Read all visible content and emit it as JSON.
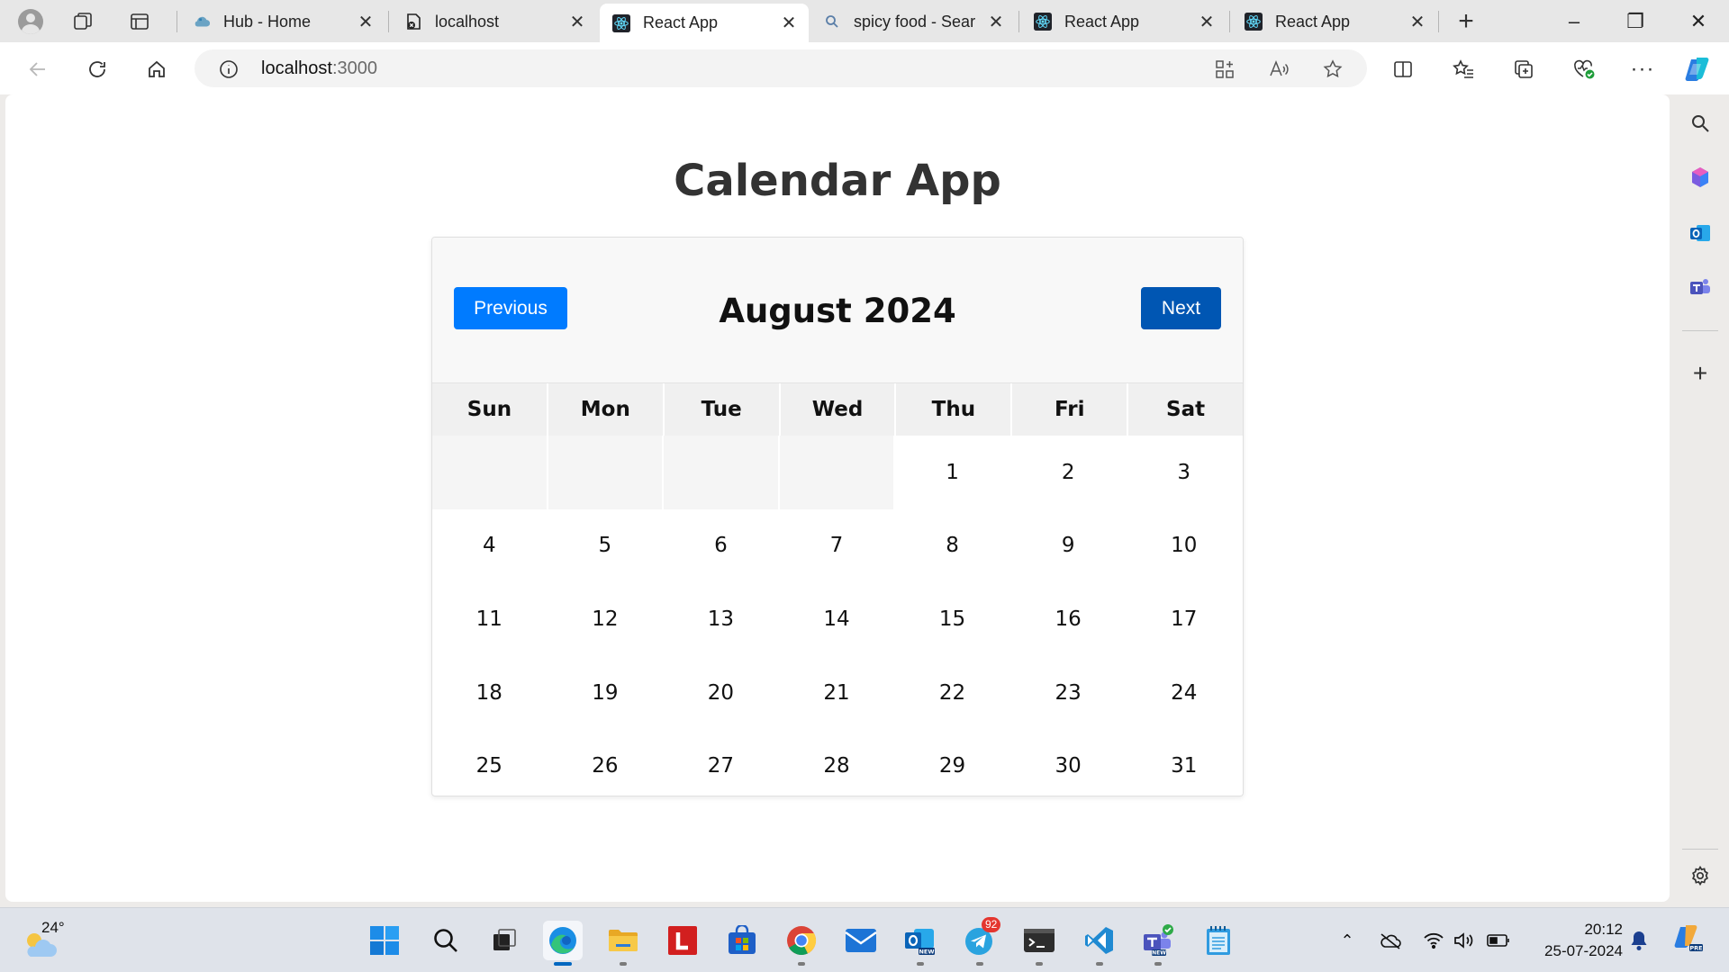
{
  "browser": {
    "tabs": [
      {
        "title": "Hub - Home",
        "favicon": "hub-cloud-icon",
        "active": false
      },
      {
        "title": "localhost",
        "favicon": "localhost-error-icon",
        "active": false
      },
      {
        "title": "React App",
        "favicon": "react-icon",
        "active": true
      },
      {
        "title": "spicy food - Sear",
        "favicon": "search-icon",
        "active": false
      },
      {
        "title": "React App",
        "favicon": "react-icon",
        "active": false
      },
      {
        "title": "React App",
        "favicon": "react-icon",
        "active": false
      }
    ],
    "new_tab_symbol": "+",
    "window_controls": {
      "minimize": "–",
      "restore": "❐",
      "close": "✕"
    },
    "address": {
      "host": "localhost",
      "port": ":3000"
    }
  },
  "page": {
    "title": "Calendar App",
    "calendar": {
      "month_label": "August 2024",
      "prev_label": "Previous",
      "next_label": "Next",
      "prev_color": "#007bff",
      "next_color": "#0056b3",
      "weekdays": [
        "Sun",
        "Mon",
        "Tue",
        "Wed",
        "Thu",
        "Fri",
        "Sat"
      ],
      "leading_blanks": 4,
      "days": [
        "1",
        "2",
        "3",
        "4",
        "5",
        "6",
        "7",
        "8",
        "9",
        "10",
        "11",
        "12",
        "13",
        "14",
        "15",
        "16",
        "17",
        "18",
        "19",
        "20",
        "21",
        "22",
        "23",
        "24",
        "25",
        "26",
        "27",
        "28",
        "29",
        "30",
        "31"
      ]
    }
  },
  "taskbar": {
    "weather_temp": "24°",
    "clock_time": "20:12",
    "clock_date": "25-07-2024",
    "telegram_badge": "92",
    "apps": [
      "windows-start-icon",
      "search-icon",
      "task-view-icon",
      "edge-icon",
      "file-explorer-icon",
      "lastpass-icon",
      "microsoft-store-icon",
      "chrome-icon",
      "mail-icon",
      "outlook-new-icon",
      "telegram-icon",
      "terminal-icon",
      "vscode-icon",
      "teams-new-icon",
      "notepad-icon"
    ]
  }
}
